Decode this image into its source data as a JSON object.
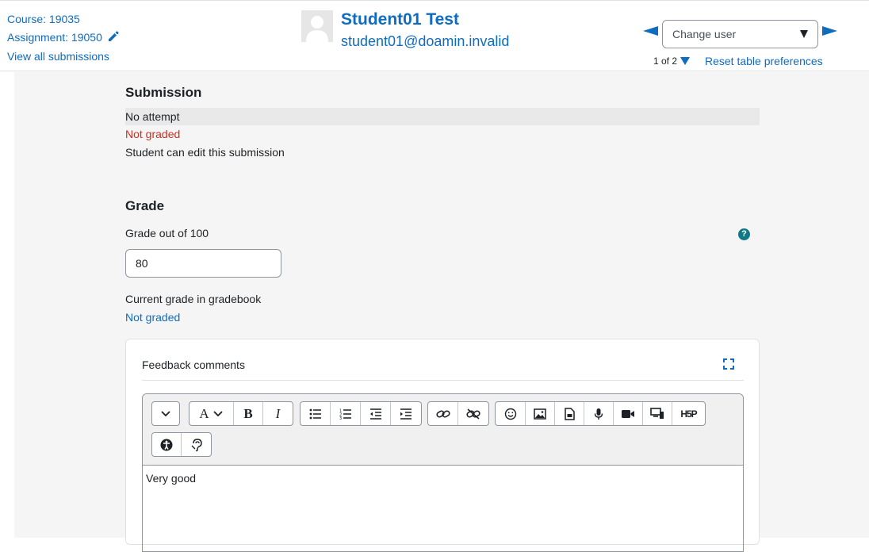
{
  "header": {
    "course_link": "Course: 19035",
    "assignment_link": "Assignment: 19050",
    "view_all_link": "View all submissions",
    "user_name": "Student01 Test",
    "user_email": "student01@doamin.invalid",
    "change_user_placeholder": "Change user",
    "pager_text": "1 of 2",
    "reset_link": "Reset table preferences"
  },
  "submission": {
    "title": "Submission",
    "attempt_status": "No attempt",
    "grading_status": "Not graded",
    "edit_status": "Student can edit this submission"
  },
  "grade": {
    "title": "Grade",
    "label": "Grade out of 100",
    "value": "80",
    "gradebook_label": "Current grade in gradebook",
    "gradebook_value": "Not graded"
  },
  "feedback": {
    "title": "Feedback comments",
    "content": "Very good"
  },
  "toolbar": {
    "bold_label": "B",
    "italic_label": "I",
    "h5p_label": "H5P",
    "font_label": "A"
  },
  "colors": {
    "link": "#0f6cbf",
    "danger": "#ca3120",
    "help": "#0f7987"
  }
}
